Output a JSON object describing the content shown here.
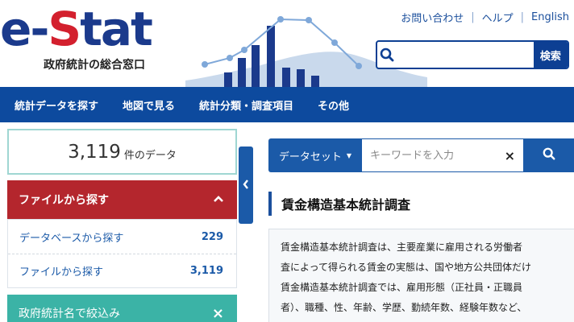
{
  "header": {
    "logo_prefix": "e-",
    "logo_s": "S",
    "logo_suffix": "tat",
    "logo_sub": "政府統計の総合窓口",
    "links": [
      "お問い合わせ",
      "ヘルプ",
      "English"
    ],
    "search": {
      "placeholder": "",
      "button": "検索",
      "icon": "search-icon"
    }
  },
  "nav": {
    "items": [
      "統計データを探す",
      "地図で見る",
      "統計分類・調査項目",
      "その他"
    ]
  },
  "sidebar": {
    "count": "3,119",
    "count_unit": "件のデータ",
    "panel": {
      "title": "ファイルから探す",
      "rows": [
        {
          "label": "データベースから探す",
          "count": "229"
        },
        {
          "label": "ファイルから探す",
          "count": "3,119"
        }
      ]
    },
    "filter": {
      "title": "政府統計名で絞込み",
      "close": "×"
    }
  },
  "main": {
    "dataset_label": "データセット",
    "keyword_placeholder": "キーワードを入力",
    "clear": "×",
    "title": "賃金構造基本統計調査",
    "desc_lines": [
      "賃金構造基本統計調査は、主要産業に雇用される労働者",
      "査によって得られる賃金の実態は、国や地方公共団体だけ",
      "賃金構造基本統計調査では、雇用形態（正社員・正職員",
      "者）、職種、性、年齢、学歴、勤続年数、経験年数など、"
    ]
  },
  "colors": {
    "brand_blue": "#1b3a8c",
    "brand_red": "#d3202e",
    "nav_blue": "#0d4a9e",
    "panel_red": "#b4262d",
    "filter_teal": "#3bb3a6"
  }
}
